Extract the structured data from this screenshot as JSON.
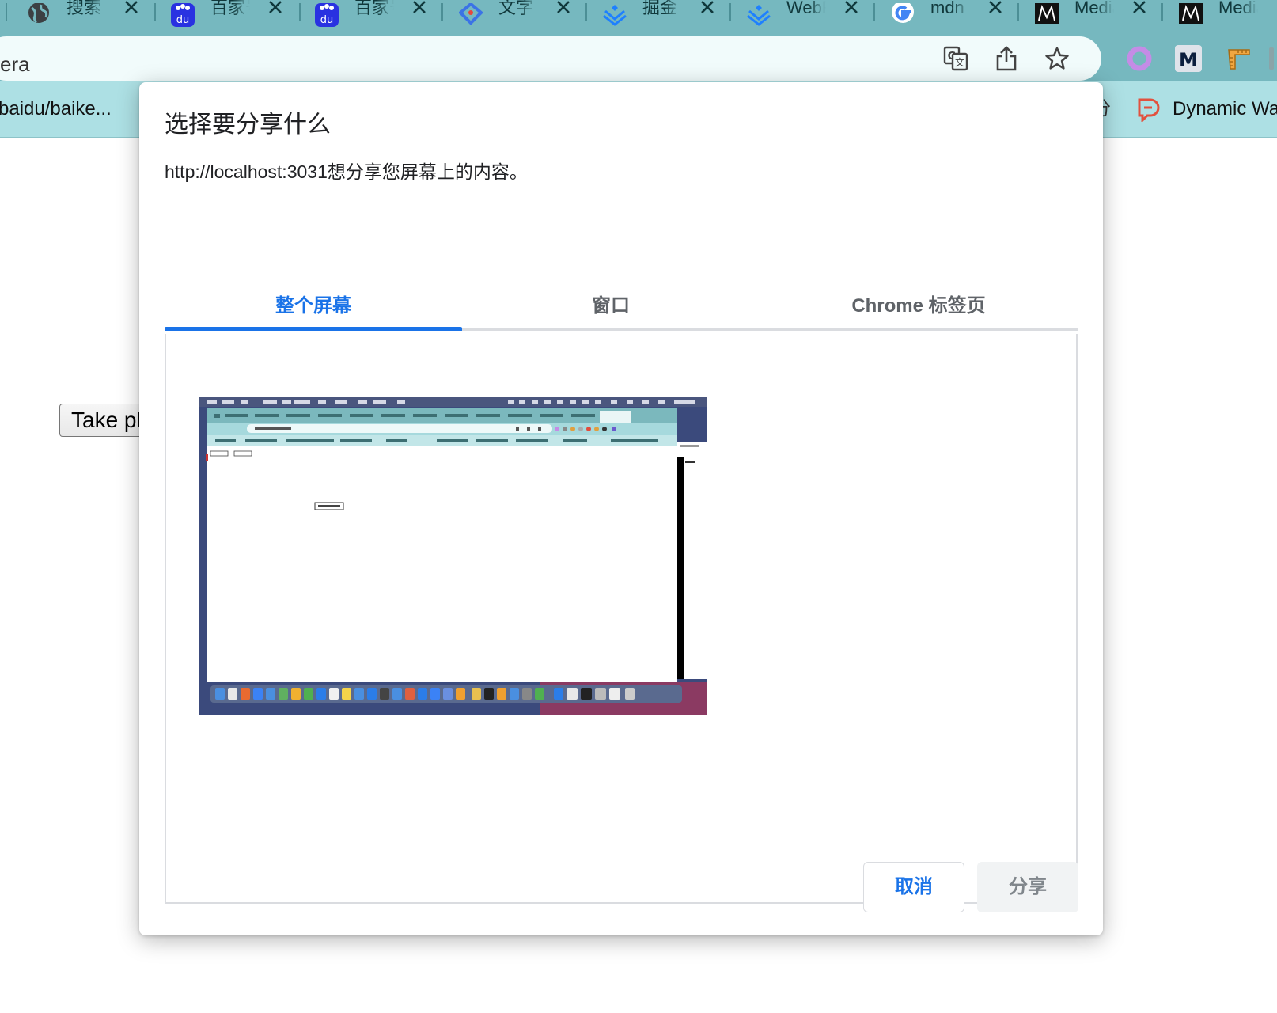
{
  "browser": {
    "tabs": [
      {
        "title": "搜索",
        "favicon": "globe-icon"
      },
      {
        "title": "百家号",
        "favicon": "baidu-icon"
      },
      {
        "title": "百家号",
        "favicon": "baidu-icon"
      },
      {
        "title": "文字",
        "favicon": "diamond-icon"
      },
      {
        "title": "掘金",
        "favicon": "juejin-icon"
      },
      {
        "title": "WebR",
        "favicon": "juejin-icon"
      },
      {
        "title": "mdn",
        "favicon": "google-icon"
      },
      {
        "title": "Media",
        "favicon": "m-logo-icon"
      },
      {
        "title": "Media",
        "favicon": "m-logo-icon"
      }
    ],
    "address_text": "era",
    "bookmarks": {
      "left_label": "baidu/baike...",
      "right_label": "Dynamic Wa",
      "partial_glyph": "分"
    },
    "colors": {
      "tabstrip": "#76b8bf",
      "bookmarks_bar": "#ade0e4",
      "omnibox": "#f1fbfb",
      "accent": "#1a73e8"
    }
  },
  "page": {
    "button_label": "Take ph"
  },
  "dialog": {
    "title": "选择要分享什么",
    "subtitle": "http://localhost:3031想分享您屏幕上的内容。",
    "tabs": [
      {
        "label": "整个屏幕",
        "active": true
      },
      {
        "label": "窗口",
        "active": false
      },
      {
        "label": "Chrome 标签页",
        "active": false
      }
    ],
    "cancel_label": "取消",
    "share_label": "分享"
  }
}
